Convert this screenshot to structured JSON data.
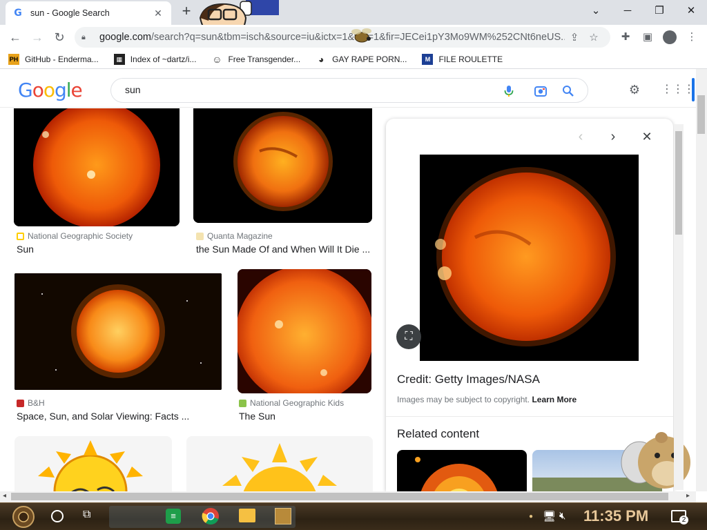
{
  "browser": {
    "tab_title": "sun - Google Search",
    "new_tab_icon": "plus-icon",
    "url_host": "google.com",
    "url_rest": "/search?q=sun&tbm=isch&source=iu&ictx=1&vet=1&fir=JECei1pY3Mo9WM%252CNt6neUS...",
    "bookmarks": [
      {
        "label": "GitHub - Enderma...",
        "icon": "PH",
        "color": "#e8a21b"
      },
      {
        "label": "Index of ~dartz/i...",
        "icon": "▦",
        "color": "#222222"
      },
      {
        "label": "Free Transgender...",
        "icon": "☺",
        "color": "#333333"
      },
      {
        "label": "GAY RAPE PORN...",
        "icon": "◕",
        "color": "#333333"
      },
      {
        "label": "FILE ROULETTE",
        "icon": "M",
        "color": "#1c3f94"
      }
    ]
  },
  "google": {
    "logo": [
      "G",
      "o",
      "o",
      "g",
      "l",
      "e"
    ],
    "logo_colors": [
      "#4285f4",
      "#ea4335",
      "#fbbc05",
      "#4285f4",
      "#34a853",
      "#ea4335"
    ],
    "query": "sun"
  },
  "results": [
    {
      "source": "National Geographic Society",
      "title": "Sun",
      "source_color": "#ffce00"
    },
    {
      "source": "Quanta Magazine",
      "title": "the Sun Made Of and When Will It Die ...",
      "source_color": "#f4e3b0"
    },
    {
      "source": "B&H",
      "title": "Space, Sun, and Solar Viewing: Facts ...",
      "source_color": "#c62828"
    },
    {
      "source": "National Geographic Kids",
      "title": "The Sun",
      "source_color": "#8bc34a"
    }
  ],
  "panel": {
    "credit": "Credit: Getty Images/NASA",
    "copyright_text": "Images may be subject to copyright.",
    "learn_more": "Learn More",
    "related_heading": "Related content"
  },
  "taskbar": {
    "clock": "11:35 PM",
    "notification_count": "2"
  }
}
